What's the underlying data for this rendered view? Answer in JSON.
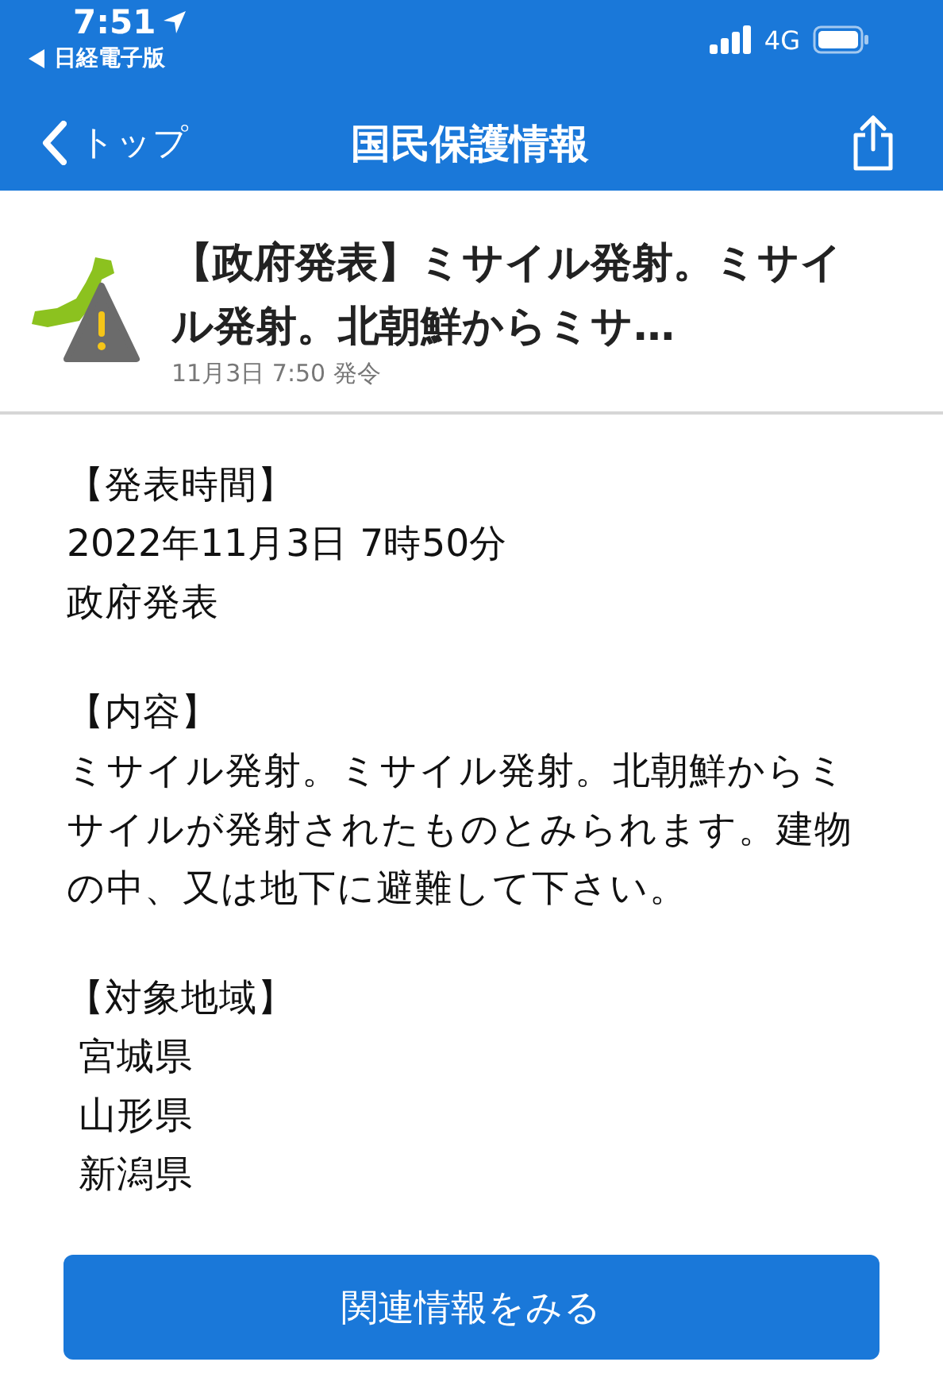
{
  "status_bar": {
    "time": "7:51",
    "back_app": "日経電子版",
    "network": "4G"
  },
  "nav": {
    "back": "トップ",
    "title": "国民保護情報"
  },
  "alert": {
    "title": "【政府発表】ミサイル発射。ミサイル発射。北朝鮮からミサ…",
    "issued": "11月3日 7:50 発令"
  },
  "sections": [
    {
      "heading": "【発表時間】",
      "lines": [
        "2022年11月3日 7時50分",
        "政府発表"
      ]
    },
    {
      "heading": "【内容】",
      "lines": [
        "ミサイル発射。ミサイル発射。北朝鮮からミサイルが発射されたものとみられます。建物の中、又は地下に避難して下さい。"
      ]
    },
    {
      "heading": "【対象地域】",
      "lines": [
        " 宮城県",
        " 山形県",
        " 新潟県"
      ]
    }
  ],
  "button": "関連情報をみる"
}
